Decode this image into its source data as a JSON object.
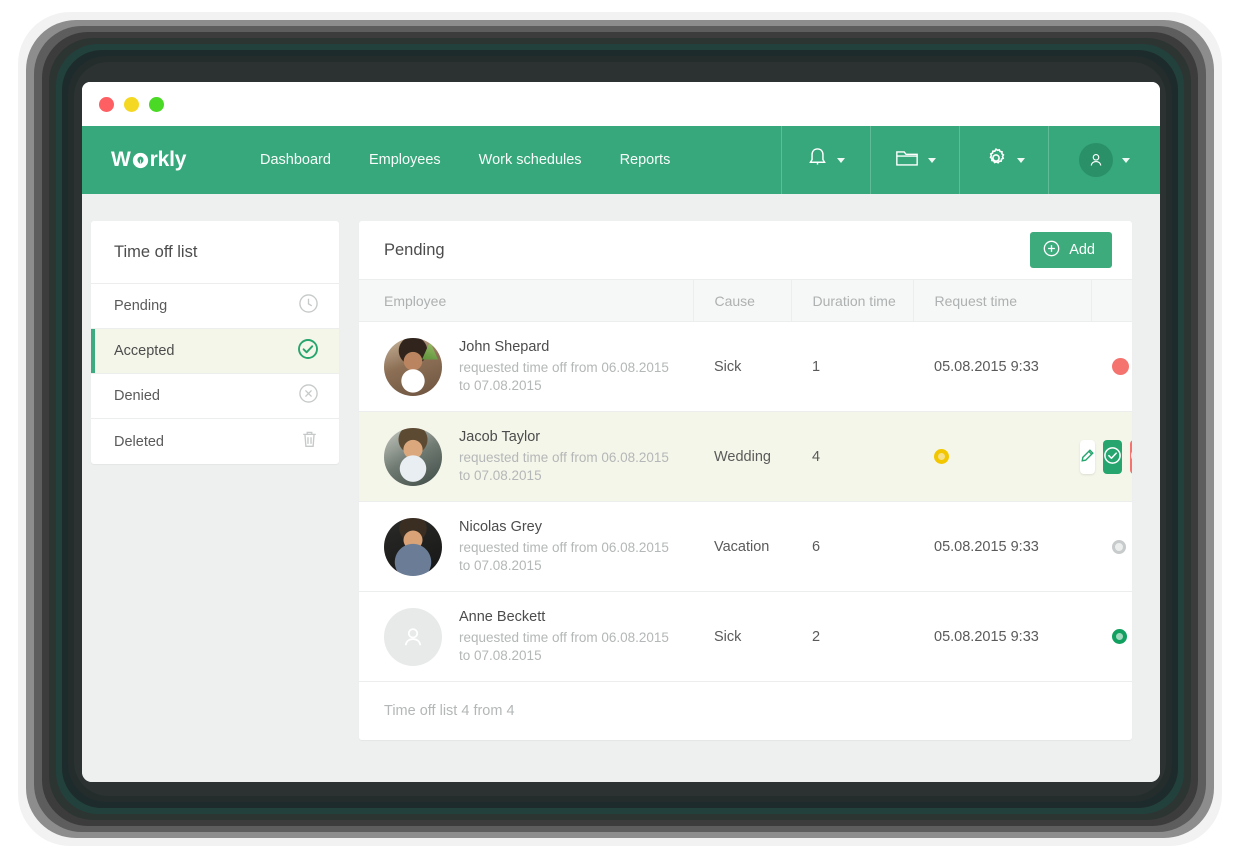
{
  "window": {
    "traffic_lights": [
      "close",
      "minimize",
      "maximize"
    ]
  },
  "navbar": {
    "logo_pre": "W",
    "logo_post": "rkly",
    "links": [
      {
        "label": "Dashboard"
      },
      {
        "label": "Employees"
      },
      {
        "label": "Work schedules"
      },
      {
        "label": "Reports"
      }
    ],
    "icons": [
      {
        "name": "bell-icon"
      },
      {
        "name": "folder-icon"
      },
      {
        "name": "gear-icon"
      },
      {
        "name": "user-avatar-icon"
      }
    ],
    "brand_color": "#36a87b"
  },
  "sidebar": {
    "title": "Time off list",
    "items": [
      {
        "label": "Pending",
        "icon": "clock-icon",
        "active": false
      },
      {
        "label": "Accepted",
        "icon": "check-circle-icon",
        "active": true
      },
      {
        "label": "Denied",
        "icon": "x-circle-icon",
        "active": false
      },
      {
        "label": "Deleted",
        "icon": "trash-icon",
        "active": false
      }
    ],
    "active_accent": "#3dab7f",
    "active_background": "#f5f6ea"
  },
  "panel": {
    "title": "Pending",
    "add_label": "Add",
    "footer": "Time off list 4 from 4",
    "columns": [
      "Employee",
      "Cause",
      "Duration time",
      "Request time",
      ""
    ],
    "rows": [
      {
        "name": "John Shepard",
        "request_line1": "requested time off from 06.08.2015",
        "request_line2": "to 07.08.2015",
        "cause": "Sick",
        "duration": "1",
        "request_time": "05.08.2015 9:33",
        "status": "solid-red",
        "status_color": "#f4736f",
        "hovered": false,
        "show_actions": false
      },
      {
        "name": "Jacob Taylor",
        "request_line1": "requested time off from 06.08.2015",
        "request_line2": "to 07.08.2015",
        "cause": "Wedding",
        "duration": "4",
        "request_time": "",
        "status": "ring-yellow",
        "status_color": "#f2c700",
        "hovered": true,
        "show_actions": true,
        "actions": [
          {
            "name": "edit-button",
            "icon": "pencil-icon"
          },
          {
            "name": "accept-button",
            "icon": "check-circle-icon"
          },
          {
            "name": "deny-button",
            "icon": "x-circle-icon"
          }
        ]
      },
      {
        "name": "Nicolas Grey",
        "request_line1": "requested time off from 06.08.2015",
        "request_line2": "to 07.08.2015",
        "cause": "Vacation",
        "duration": "6",
        "request_time": "05.08.2015 9:33",
        "status": "ring-grey",
        "status_color": "#c8cbcb",
        "hovered": false,
        "show_actions": false
      },
      {
        "name": "Anne Beckett",
        "request_line1": "requested time off from 06.08.2015",
        "request_line2": "to 07.08.2015",
        "cause": "Sick",
        "duration": "2",
        "request_time": "05.08.2015 9:33",
        "status": "ring-green",
        "status_color": "#11a05f",
        "hovered": false,
        "show_actions": false
      }
    ]
  }
}
